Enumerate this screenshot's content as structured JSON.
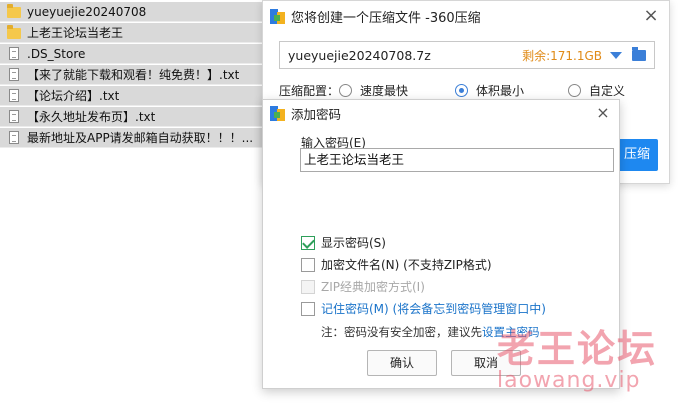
{
  "files": [
    {
      "type": "folder",
      "name": "yueyuejie20240708"
    },
    {
      "type": "folder",
      "name": "上老王论坛当老王"
    },
    {
      "type": "doc",
      "name": ".DS_Store"
    },
    {
      "type": "doc",
      "name": "【来了就能下载和观看！纯免费！】.txt"
    },
    {
      "type": "doc",
      "name": "【论坛介绍】.txt"
    },
    {
      "type": "doc",
      "name": "【永久地址发布页】.txt"
    },
    {
      "type": "doc",
      "name": "最新地址及APP请发邮箱自动获取！！！..."
    }
  ],
  "compress_dialog": {
    "title": "您将创建一个压缩文件 -360压缩",
    "close": "×",
    "archive_path": "yueyuejie20240708.7z",
    "free_space": "剩余:171.1GB",
    "config_label": "压缩配置：",
    "options": [
      "速度最快",
      "体积最小",
      "自定义"
    ],
    "selected_option": "体积最小",
    "start_button": "压缩"
  },
  "password_dialog": {
    "title": "添加密码",
    "close": "×",
    "input_label": "输入密码(E)",
    "password_value": "上老王论坛当老王",
    "show_password": "显示密码(S)",
    "encrypt_filename": "加密文件名(N) (不支持ZIP格式)",
    "zip_classic": "ZIP经典加密方式(I)",
    "remember_password": "记住密码(M) (将会备忘到密码管理窗口中)",
    "note_prefix": "注：密码没有安全加密，建议先",
    "note_link": "设置主密码",
    "ok": "确认",
    "cancel": "取消"
  },
  "watermark": {
    "cn": "老王论坛",
    "en": "laowang.vip"
  }
}
